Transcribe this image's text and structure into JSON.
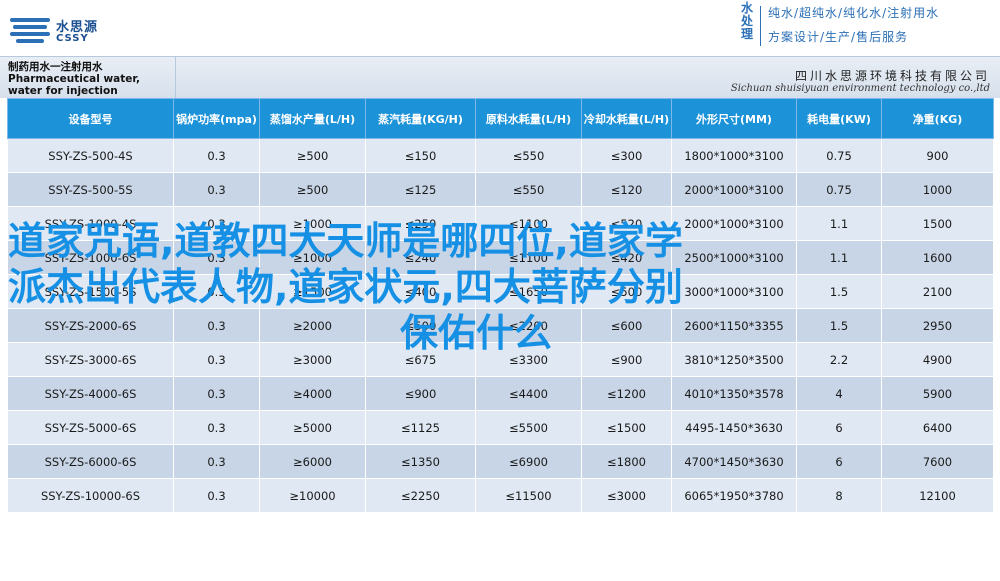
{
  "header": {
    "logo_cn": "水思源",
    "logo_en": "CSSY",
    "brand_vertical": "水处理",
    "slogan_line1": "纯水/超纯水/纯化水/注射用水",
    "slogan_line2": "方案设计/生产/售后服务",
    "brand_color": "#2b6fb6"
  },
  "title_band": {
    "product_title": "制药用水一注射用水 Pharmaceutical water, water for injection",
    "company_cn": "四川水思源环境科技有限公司",
    "company_en": "Sichuan shuisiyuan environment technology co.,ltd"
  },
  "table": {
    "header_color": "#1c92d8",
    "columns": [
      "设备型号",
      "锅炉功率(mpa)",
      "蒸馏水产量(L/H)",
      "蒸汽耗量(KG/H)",
      "原料水耗量(L/H)",
      "冷却水耗量(L/H)",
      "外形尺寸(MM)",
      "耗电量(KW)",
      "净重(KG)"
    ],
    "rows": [
      [
        "SSY-ZS-500-4S",
        "0.3",
        "≥500",
        "≤150",
        "≤550",
        "≤300",
        "1800*1000*3100",
        "0.75",
        "900"
      ],
      [
        "SSY-ZS-500-5S",
        "0.3",
        "≥500",
        "≤125",
        "≤550",
        "≤120",
        "2000*1000*3100",
        "0.75",
        "1000"
      ],
      [
        "SSY-ZS-1000-4S",
        "0.3",
        "≥1000",
        "≤250",
        "≤1100",
        "≤520",
        "2000*1000*3100",
        "1.1",
        "1500"
      ],
      [
        "SSY-ZS-1000-6S",
        "0.3",
        "≥1000",
        "≤240",
        "≤1100",
        "≤420",
        "2500*1000*3100",
        "1.1",
        "1600"
      ],
      [
        "SSY-ZS-1500-5S",
        "0.3",
        "≥1500",
        "≤400",
        "≤1650",
        "≤500",
        "3000*1000*3100",
        "1.5",
        "2100"
      ],
      [
        "SSY-ZS-2000-6S",
        "0.3",
        "≥2000",
        "≤500",
        "≤2200",
        "≤600",
        "2600*1150*3355",
        "1.5",
        "2950"
      ],
      [
        "SSY-ZS-3000-6S",
        "0.3",
        "≥3000",
        "≤675",
        "≤3300",
        "≤900",
        "3810*1250*3500",
        "2.2",
        "4900"
      ],
      [
        "SSY-ZS-4000-6S",
        "0.3",
        "≥4000",
        "≤900",
        "≤4400",
        "≤1200",
        "4010*1350*3578",
        "4",
        "5900"
      ],
      [
        "SSY-ZS-5000-6S",
        "0.3",
        "≥5000",
        "≤1125",
        "≤5500",
        "≤1500",
        "4495-1450*3630",
        "6",
        "6400"
      ],
      [
        "SSY-ZS-6000-6S",
        "0.3",
        "≥6000",
        "≤1350",
        "≤6900",
        "≤1800",
        "4700*1450*3630",
        "6",
        "7600"
      ],
      [
        "SSY-ZS-10000-6S",
        "0.3",
        "≥10000",
        "≤2250",
        "≤11500",
        "≤3000",
        "6065*1950*3780",
        "8",
        "12100"
      ]
    ]
  },
  "overlay": {
    "line1": "道家咒语,道教四大天师是哪四位,道家学",
    "line2": "派杰出代表人物,道家状元,四大菩萨分别",
    "line3": "保佑什么",
    "color": "#1590e4"
  }
}
